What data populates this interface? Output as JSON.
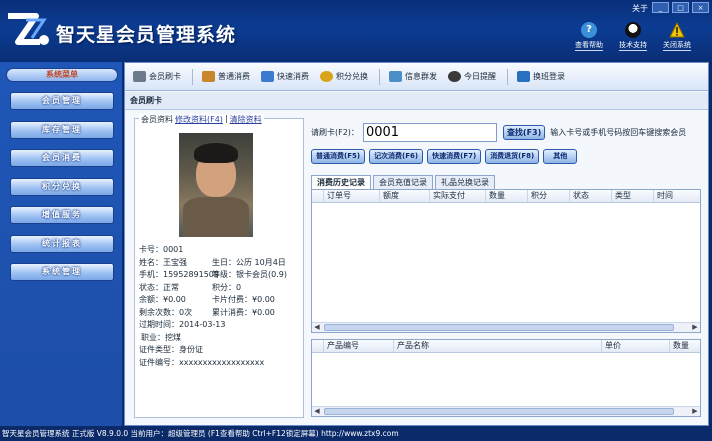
{
  "app": {
    "title": "智天星会员管理系统",
    "about": "关于",
    "window_buttons": [
      "_",
      "□",
      "×"
    ]
  },
  "top_tools": [
    {
      "label": "查看帮助",
      "icon": "help-icon",
      "color": "#3a8fd8"
    },
    {
      "label": "技术支持",
      "icon": "qq-penguin-icon",
      "color": "#e02020"
    },
    {
      "label": "关闭系统",
      "icon": "warning-icon",
      "color": "#f2c500"
    }
  ],
  "sidebar": {
    "header": "系统菜单",
    "items": [
      "会员管理",
      "库存管理",
      "会员消费",
      "积分兑换",
      "增值服务",
      "统计报表",
      "系统管理"
    ]
  },
  "toolbar": {
    "items": [
      {
        "label": "会员刷卡",
        "icon": "card-icon",
        "color": "#6b7b8c"
      },
      {
        "label": "普通消费",
        "icon": "cash-icon",
        "color": "#c8872a"
      },
      {
        "label": "快速消费",
        "icon": "fast-icon",
        "color": "#3a7bd0"
      },
      {
        "label": "积分兑换",
        "icon": "points-icon",
        "color": "#d9a41a"
      },
      {
        "label": "信息群发",
        "icon": "message-icon",
        "color": "#4a8fc8"
      },
      {
        "label": "今日提醒",
        "icon": "clock-icon",
        "color": "#3a3a3a"
      },
      {
        "label": "换班登录",
        "icon": "shift-icon",
        "color": "#2a70c0"
      }
    ]
  },
  "section_title": "会员刷卡",
  "member": {
    "tab_label": "会员资料",
    "edit_link": "修改资料(F4)",
    "clear_link": "清除资料",
    "card_no": "卡号：0001",
    "name": "姓名：王宝强",
    "birthday": "生日：公历 10月4日",
    "phone": "手机：15952891509",
    "level": "等级：银卡会员(0.9)",
    "status": "状态：正常",
    "points": "积分：0",
    "balance": "余额：¥0.00",
    "card_fee": "卡片付费：¥0.00",
    "remaining": "剩余次数：0次",
    "total_spent": "累计消费：¥0.00",
    "expire": "过期时间：2014-03-13",
    "job": "职业：挖煤",
    "id_type": "证件类型：身份证",
    "id_no": "证件编号：xxxxxxxxxxxxxxxxxx"
  },
  "swipe": {
    "label": "请刷卡(F2)：",
    "value": "0001",
    "find_button": "查找(F3)",
    "hint": "输入卡号或手机号码按回车键搜索会员"
  },
  "actions": [
    "普通消费(F5)",
    "记次消费(F6)",
    "快速消费(F7)",
    "消费退货(F8)",
    "其他"
  ],
  "history_tabs": [
    "消费历史记录",
    "会员充值记录",
    "礼品兑换记录"
  ],
  "history_columns": [
    "订单号",
    "额度",
    "实际支付",
    "数量",
    "积分",
    "状态",
    "类型",
    "时间"
  ],
  "product_columns": [
    "产品编号",
    "产品名称",
    "单价",
    "数量"
  ],
  "status_bar": "智天星会员管理系统 正式版 V8.9.0.0  当前用户：超级管理员 (F1查看帮助 Ctrl+F12锁定屏幕)      http://www.ztx9.com"
}
